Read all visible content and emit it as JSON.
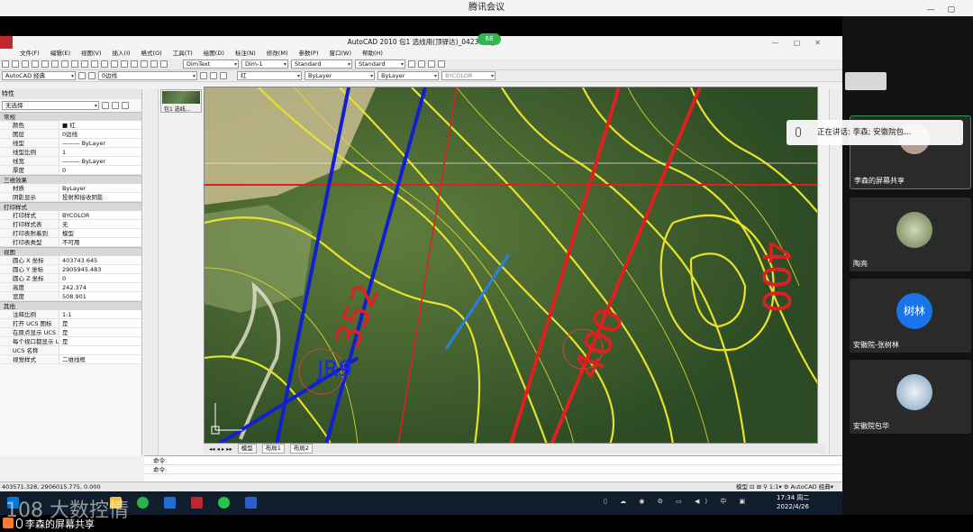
{
  "meeting": {
    "title": "腾讯会议",
    "share_badge": "68",
    "speaking_text": "正在讲话: 李森; 安徽院包...",
    "participants": [
      {
        "name": "李森的屏幕共享"
      },
      {
        "name": "陶亮"
      },
      {
        "name": "安徽院-张树林",
        "avatar_text": "树林"
      },
      {
        "name": "安徽院包华"
      }
    ],
    "bottom_label": "李森的屏幕共享",
    "watermark": "108 大数控情"
  },
  "cad": {
    "title": "AutoCAD 2010    包1 选线用(顶驿达)_0423.dwg",
    "menu": [
      "文件(F)",
      "编辑(E)",
      "视图(V)",
      "插入(I)",
      "格式(O)",
      "工具(T)",
      "绘图(D)",
      "标注(N)",
      "修改(M)",
      "参数(P)",
      "窗口(W)",
      "帮助(H)"
    ],
    "toolbar": {
      "dimtext": "DimText",
      "dim": "Dim-1",
      "standard1": "Standard",
      "standard2": "Standard",
      "workspace": "AutoCAD 经典",
      "layer": "0边线",
      "color": "红",
      "linetype1": "ByLayer",
      "linetype2": "ByLayer",
      "plotstyle": "BYCOLOR"
    },
    "props": {
      "header": "特性",
      "selection": "无选择",
      "sections": [
        {
          "title": "常规",
          "rows": [
            [
              "颜色",
              "■ 红"
            ],
            [
              "图层",
              "0边线"
            ],
            [
              "线型",
              "——— ByLayer"
            ],
            [
              "线型比例",
              "1"
            ],
            [
              "线宽",
              "——— ByLayer"
            ],
            [
              "厚度",
              "0"
            ]
          ]
        },
        {
          "title": "三维效果",
          "rows": [
            [
              "材质",
              "ByLayer"
            ],
            [
              "阴影显示",
              "投射和接收阴影"
            ]
          ]
        },
        {
          "title": "打印样式",
          "rows": [
            [
              "打印样式",
              "BYCOLOR"
            ],
            [
              "打印样式表",
              "无"
            ],
            [
              "打印表附着到",
              "模型"
            ],
            [
              "打印表类型",
              "不可用"
            ]
          ]
        },
        {
          "title": "视图",
          "rows": [
            [
              "圆心 X 坐标",
              "403743.645"
            ],
            [
              "圆心 Y 坐标",
              "2905945.483"
            ],
            [
              "圆心 Z 坐标",
              "0"
            ],
            [
              "高度",
              "242.374"
            ],
            [
              "宽度",
              "508.901"
            ]
          ]
        },
        {
          "title": "其他",
          "rows": [
            [
              "注释比例",
              "1:1"
            ],
            [
              "打开 UCS 图标",
              "是"
            ],
            [
              "在原点显示 UCS ...",
              "是"
            ],
            [
              "每个视口都显示 U...",
              "是"
            ],
            [
              "UCS 名称",
              ""
            ],
            [
              "视觉样式",
              "二维线框"
            ]
          ]
        }
      ]
    },
    "thumb_label": "包1 选线...",
    "map_labels": {
      "jr9": "JR9",
      "l352": "352",
      "l400a": "400",
      "l400b": "400"
    },
    "tabs": [
      "模型",
      "布局1",
      "布局2"
    ],
    "command_prompt": "命令:",
    "status_coords": "403571.328, 2906015.775, 0.000",
    "status_right": "模型  ⊡  ⊞  ⚲  1:1▾  ⚙  AutoCAD 经典▾"
  },
  "taskbar": {
    "time": "17:34 周二",
    "date": "2022/4/26"
  }
}
